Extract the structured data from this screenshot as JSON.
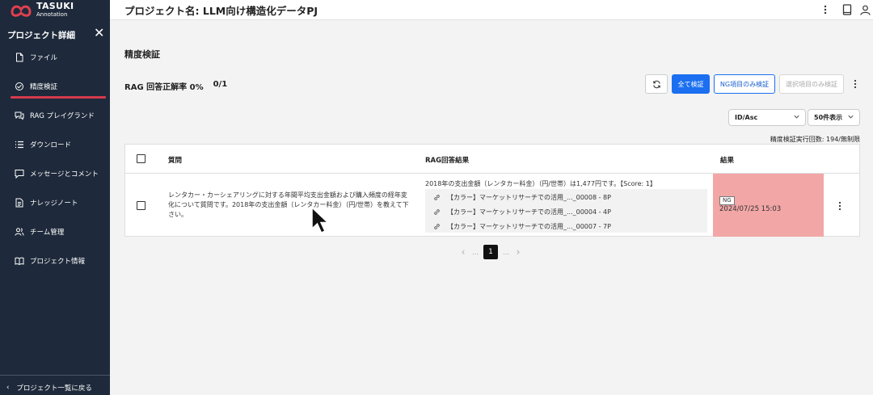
{
  "logo": {
    "line1": "TASUKI",
    "line2": "Annotation"
  },
  "sidebar": {
    "title": "プロジェクト詳細",
    "items": [
      {
        "label": "ファイル",
        "icon": "file-icon"
      },
      {
        "label": "精度検証",
        "icon": "verify-icon",
        "active": true
      },
      {
        "label": "RAG プレイグランド",
        "icon": "chat-icon"
      },
      {
        "label": "ダウンロード",
        "icon": "list-icon"
      },
      {
        "label": "メッセージとコメント",
        "icon": "message-icon"
      },
      {
        "label": "ナレッジノート",
        "icon": "note-icon"
      },
      {
        "label": "チーム管理",
        "icon": "team-icon"
      },
      {
        "label": "プロジェクト情報",
        "icon": "book-icon"
      }
    ],
    "back_label": "プロジェクト一覧に戻る"
  },
  "header": {
    "title": "プロジェクト名: LLM向け構造化データPJ"
  },
  "main": {
    "page_title": "精度検証",
    "score_label": "RAG 回答正解率 0%",
    "score_count": "0/1",
    "buttons": {
      "verify_all": "全て検証",
      "verify_ng": "NG項目のみ検証",
      "verify_selected": "選択項目のみ検証"
    },
    "sort_select": "ID/Asc",
    "count_select": "50件表示",
    "exec_count": "精度検証実行回数: 194/無制限",
    "table": {
      "headers": {
        "question": "質問",
        "answer": "RAG回答結果",
        "result": "結果"
      },
      "rows": [
        {
          "question": "レンタカー・カーシェアリングに対する年間平均支出金額および購入頻度の経年変化について質問です。2018年の支出金額（レンタカー料金）（円/世帯）を教えて下さい。",
          "answer": "2018年の支出金額（レンタカー料金）（円/世帯）は1,477円です。【Score: 1】",
          "refs": [
            "【カラー】マーケットリサーチでの活用_..._00008 - 8P",
            "【カラー】マーケットリサーチでの活用_..._00004 - 4P",
            "【カラー】マーケットリサーチでの活用_..._00007 - 7P"
          ],
          "result_badge": "NG",
          "result_date": "2024/07/25 15:03"
        }
      ]
    },
    "pagination": {
      "current": "1",
      "ellipsis": "…"
    }
  },
  "colors": {
    "sidebar_bg": "#1e2a3b",
    "accent": "#d63a4d",
    "primary": "#1b6ff0",
    "ng_bg": "#f2a6a6"
  }
}
